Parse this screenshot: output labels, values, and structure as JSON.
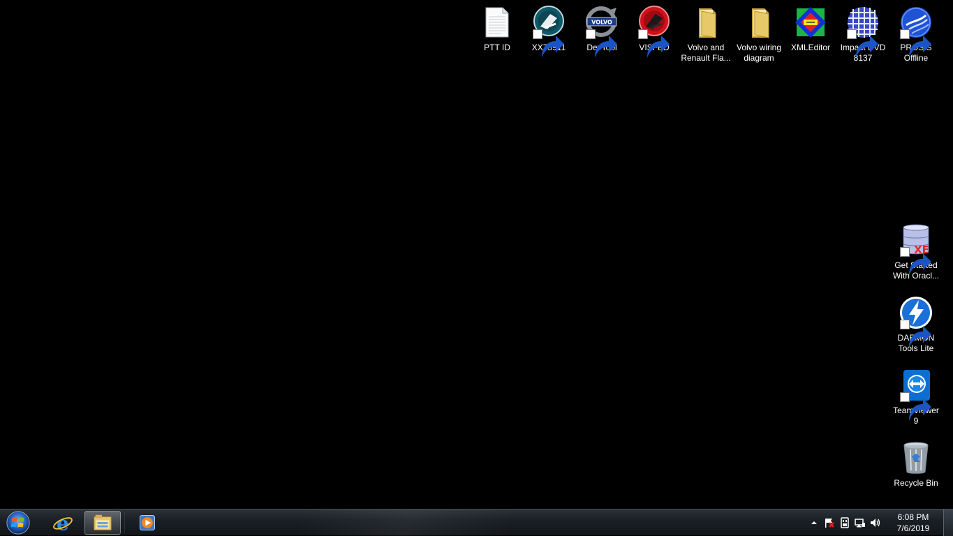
{
  "desktop": {
    "icons": [
      {
        "label": "PTT ID",
        "icon": "text-file-icon",
        "shortcut": false
      },
      {
        "label": "XX78911",
        "icon": "xx-app-icon",
        "shortcut": true
      },
      {
        "label": "DevTool",
        "icon": "volvo-logo-icon",
        "shortcut": true
      },
      {
        "label": "VISFED",
        "icon": "visfed-app-icon",
        "shortcut": true
      },
      {
        "label": "Volvo and\nRenault Fla...",
        "icon": "folder-icon",
        "shortcut": false
      },
      {
        "label": "Volvo wiring\ndiagram",
        "icon": "folder-icon",
        "shortcut": false
      },
      {
        "label": "XMLEditor",
        "icon": "xml-editor-icon",
        "shortcut": false
      },
      {
        "label": "Impact DVD\n8137",
        "icon": "impact-grid-icon",
        "shortcut": true
      },
      {
        "label": "PROSIS\nOffline",
        "icon": "prosis-icon",
        "shortcut": true
      },
      {
        "label": "Get Started\nWith Oracl...",
        "icon": "oracle-database-icon",
        "shortcut": true
      },
      {
        "label": "DAEMON\nTools Lite",
        "icon": "daemon-tools-icon",
        "shortcut": true
      },
      {
        "label": "TeamViewer\n9",
        "icon": "teamviewer-icon",
        "shortcut": true
      },
      {
        "label": "Recycle Bin",
        "icon": "recycle-bin-icon",
        "shortcut": false
      }
    ]
  },
  "taskbar": {
    "start": "windows-start-orb-icon",
    "pinned": [
      {
        "name": "internet-explorer",
        "icon": "internet-explorer-icon"
      },
      {
        "name": "windows-explorer",
        "icon": "file-explorer-icon",
        "active": true
      },
      {
        "name": "media-player",
        "icon": "media-player-icon"
      }
    ],
    "tray": [
      "show-hidden-icons-arrow-icon",
      "flag-warning-icon",
      "usb-device-icon",
      "network-icon",
      "volume-icon"
    ],
    "clock": {
      "time": "6:08 PM",
      "date": "7/6/2019"
    }
  },
  "colors": {
    "desktop_background": "#000000",
    "folder": "#e8c96a",
    "volvo_blue": "#1c3c8c",
    "visfed_red": "#d0101a",
    "teamviewer_blue": "#0e6ed0"
  }
}
